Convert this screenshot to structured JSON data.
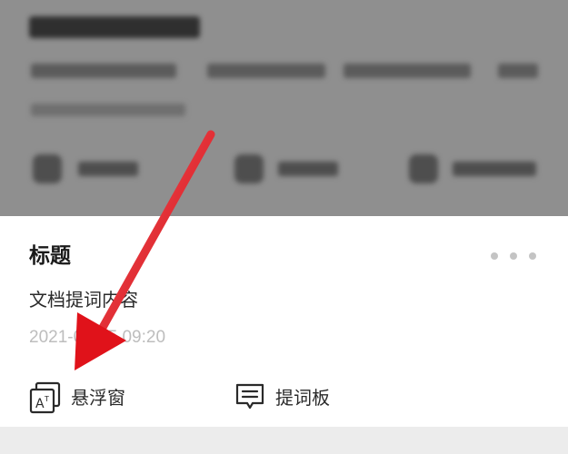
{
  "card": {
    "title": "标题",
    "content": "文档提词内容",
    "timestamp": "2021-01-15 09:20",
    "more_icon": "more-horizontal-icon"
  },
  "actions": [
    {
      "label": "悬浮窗",
      "icon": "floating-window-icon"
    },
    {
      "label": "提词板",
      "icon": "prompter-board-icon"
    }
  ],
  "colors": {
    "overlay": "#8f8f8f",
    "card": "#ffffff",
    "arrow": "#e8141b",
    "muted_text": "#bdbdbd"
  }
}
